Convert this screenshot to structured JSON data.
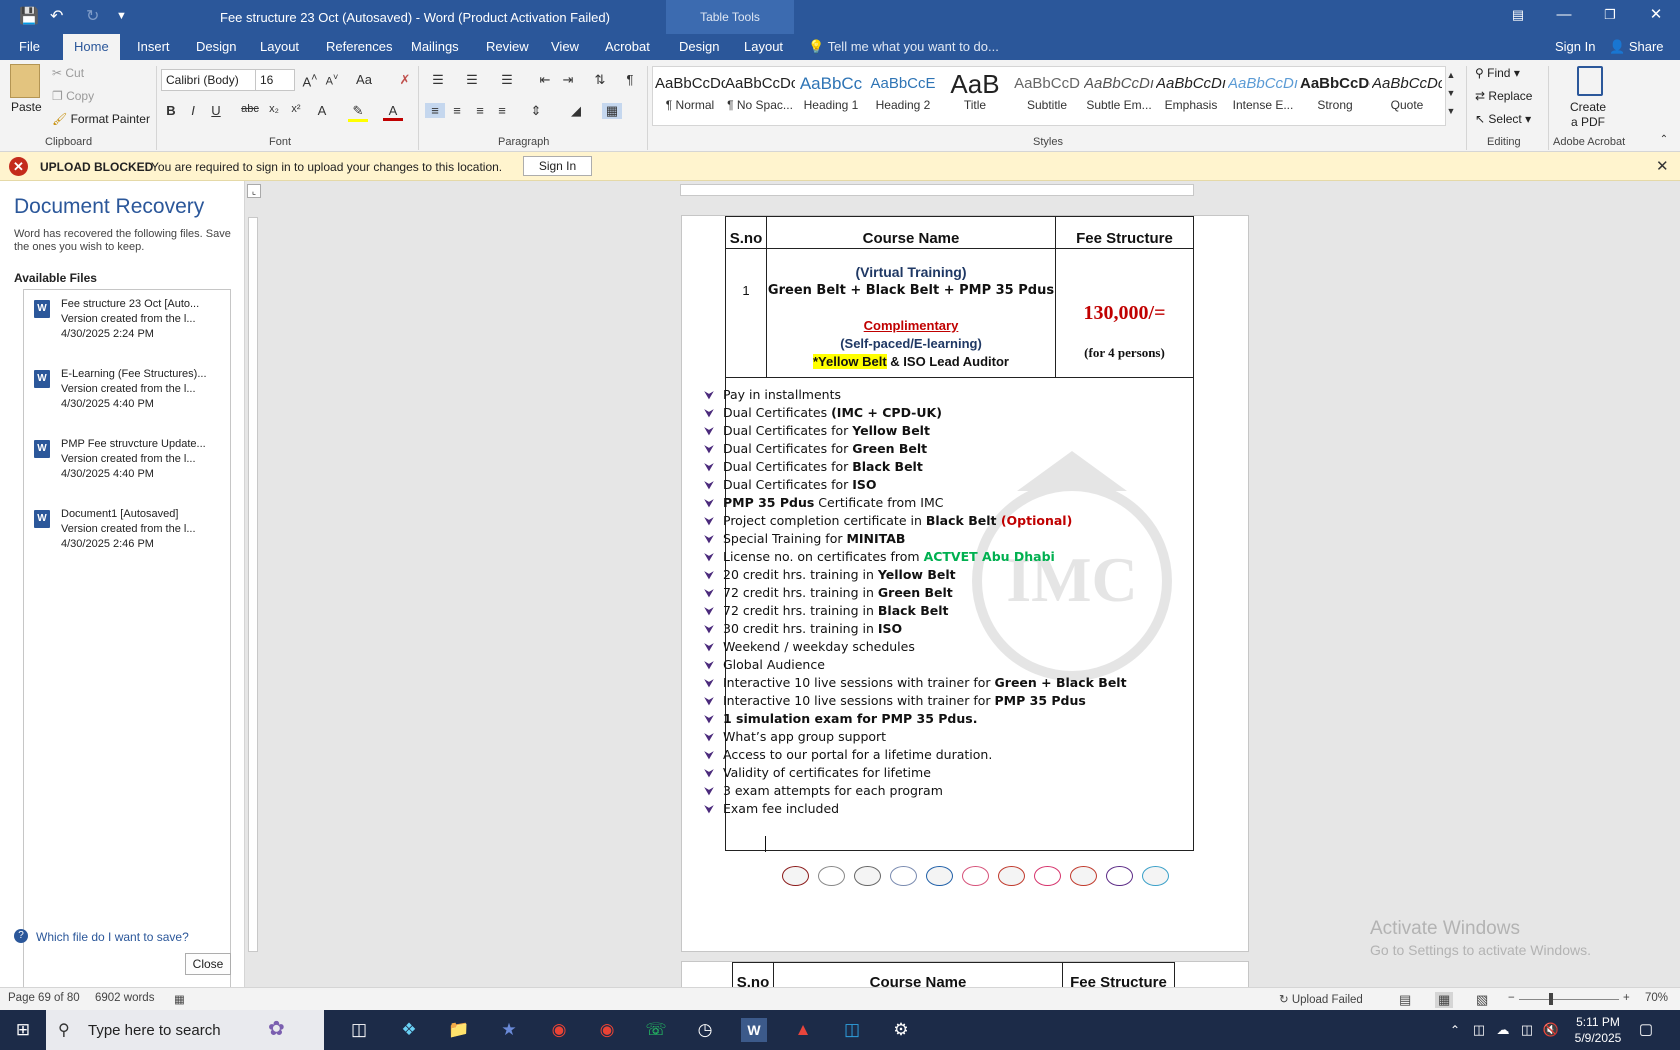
{
  "titlebar": {
    "doc_title": "Fee structure 23 Oct (Autosaved) - Word (Product Activation Failed)",
    "table_tools": "Table Tools"
  },
  "tabs": [
    "File",
    "Home",
    "Insert",
    "Design",
    "Layout",
    "References",
    "Mailings",
    "Review",
    "View",
    "Acrobat",
    "Design",
    "Layout"
  ],
  "tellme": "Tell me what you want to do...",
  "signin": "Sign In",
  "share": "Share",
  "ribbon": {
    "clipboard": {
      "paste": "Paste",
      "cut": "Cut",
      "copy": "Copy",
      "format_painter": "Format Painter",
      "label": "Clipboard"
    },
    "font": {
      "family": "Calibri (Body)",
      "size": "16",
      "label": "Font"
    },
    "paragraph": {
      "label": "Paragraph"
    },
    "styles": {
      "label": "Styles",
      "items": [
        {
          "sample": "AaBbCcDc",
          "name": "¶ Normal"
        },
        {
          "sample": "AaBbCcDc",
          "name": "¶ No Spac..."
        },
        {
          "sample": "AaBbCc",
          "name": "Heading 1"
        },
        {
          "sample": "AaBbCcE",
          "name": "Heading 2"
        },
        {
          "sample": "AaB",
          "name": "Title"
        },
        {
          "sample": "AaBbCcD",
          "name": "Subtitle"
        },
        {
          "sample": "AaBbCcDı",
          "name": "Subtle Em..."
        },
        {
          "sample": "AaBbCcDı",
          "name": "Emphasis"
        },
        {
          "sample": "AaBbCcDı",
          "name": "Intense E..."
        },
        {
          "sample": "AaBbCcDc",
          "name": "Strong"
        },
        {
          "sample": "AaBbCcDc",
          "name": "Quote"
        }
      ]
    },
    "editing": {
      "find": "Find",
      "replace": "Replace",
      "select": "Select",
      "label": "Editing"
    },
    "acrobat": {
      "create_pdf_1": "Create",
      "create_pdf_2": "a PDF",
      "label": "Adobe Acrobat"
    }
  },
  "message": {
    "title": "UPLOAD BLOCKED",
    "text": "You are required to sign in to upload your changes to this location.",
    "button": "Sign In"
  },
  "recovery": {
    "title": "Document Recovery",
    "desc": "Word has recovered the following files. Save the ones you wish to keep.",
    "available": "Available Files",
    "files": [
      {
        "name": "Fee structure 23 Oct  [Auto...",
        "sub": "Version created from the l...",
        "time": "4/30/2025 2:24 PM"
      },
      {
        "name": "E-Learning (Fee Structures)...",
        "sub": "Version created from the l...",
        "time": "4/30/2025 4:40 PM"
      },
      {
        "name": "PMP Fee struvcture Update...",
        "sub": "Version created from the l...",
        "time": "4/30/2025 4:40 PM"
      },
      {
        "name": "Document1  [Autosaved]",
        "sub": "Version created from the l...",
        "time": "4/30/2025 2:46 PM"
      }
    ],
    "help": "Which file do I want to save?",
    "close": "Close"
  },
  "document": {
    "headers": {
      "sno": "S.no",
      "course": "Course Name",
      "fee": "Fee Structure"
    },
    "row": {
      "sno": "1",
      "virtual": "(Virtual Training)",
      "course": "Green Belt + Black Belt + PMP 35 Pdus",
      "complimentary": "Complimentary",
      "selfpaced": "(Self-paced/E-learning)",
      "yellow": "*Yellow Belt",
      "iso": " & ISO Lead Auditor",
      "fee": "130,000/=",
      "persons": "(for 4 persons)"
    },
    "features": [
      {
        "a": "Pay in installments",
        "b": "",
        "c": ""
      },
      {
        "a": "Dual Certificates ",
        "b": "(IMC + CPD-UK)",
        "c": ""
      },
      {
        "a": "Dual Certificates for ",
        "b": "Yellow Belt",
        "c": ""
      },
      {
        "a": "Dual Certificates for ",
        "b": "Green Belt",
        "c": ""
      },
      {
        "a": "Dual Certificates for ",
        "b": "Black Belt",
        "c": ""
      },
      {
        "a": " Dual Certificates for ",
        "b": "ISO",
        "c": ""
      },
      {
        "a": "",
        "b": "PMP 35 Pdus",
        "c": " Certificate from IMC"
      },
      {
        "a": "Project completion certificate in ",
        "b": "Black Belt",
        "c": "",
        "red": " (Optional)"
      },
      {
        "a": "Special Training for ",
        "b": "MINITAB",
        "c": ""
      },
      {
        "a": "License no. on certificates from ",
        "b": "",
        "c": "",
        "green": "ACTVET Abu Dhabi"
      },
      {
        "a": "20 credit hrs. training in ",
        "b": "Yellow Belt",
        "c": ""
      },
      {
        "a": "72 credit hrs. training in ",
        "b": "Green Belt",
        "c": ""
      },
      {
        "a": "72 credit hrs. training in ",
        "b": "Black Belt",
        "c": ""
      },
      {
        "a": "30 credit hrs. training in ",
        "b": "ISO",
        "c": ""
      },
      {
        "a": "Weekend / weekday schedules",
        "b": "",
        "c": ""
      },
      {
        "a": "Global Audience",
        "b": "",
        "c": ""
      },
      {
        "a": "Interactive 10 live sessions with trainer for ",
        "b": "Green + Black Belt",
        "c": ""
      },
      {
        "a": "Interactive 10 live sessions with trainer for ",
        "b": "PMP 35 Pdus",
        "c": ""
      },
      {
        "a": "",
        "b": "1 simulation exam for PMP 35 Pdus.",
        "c": ""
      },
      {
        "a": "What’s app group support",
        "b": "",
        "c": ""
      },
      {
        "a": "Access to our portal for a lifetime duration.",
        "b": "",
        "c": ""
      },
      {
        "a": "Validity of certificates for lifetime",
        "b": "",
        "c": ""
      },
      {
        "a": "3 exam attempts for each program",
        "b": "",
        "c": ""
      },
      {
        "a": "Exam fee included",
        "b": "",
        "c": ""
      }
    ],
    "cert_logos": [
      "IASSC",
      "seal",
      "BE",
      "CPD",
      "ISO",
      "PeopleCert",
      "PECB",
      "maple",
      "seal-2",
      "b",
      "ASQ"
    ],
    "page2_headers": {
      "sno": "S.no",
      "course": "Course Name",
      "fee": "Fee Structure"
    }
  },
  "watermark": {
    "text": "IMC"
  },
  "activate": {
    "line1": "Activate Windows",
    "line2": "Go to Settings to activate Windows."
  },
  "status": {
    "page": "Page 69 of 80",
    "words": "6902 words",
    "upload": "Upload Failed",
    "zoom": "70%"
  },
  "taskbar": {
    "search": "Type here to search",
    "time": "5:11 PM",
    "date": "5/9/2025"
  },
  "colors": {
    "brand": "#2b579a",
    "fee_red": "#c00000",
    "navy": "#1f3864",
    "green": "#00b050",
    "highlight": "#ffff00"
  }
}
